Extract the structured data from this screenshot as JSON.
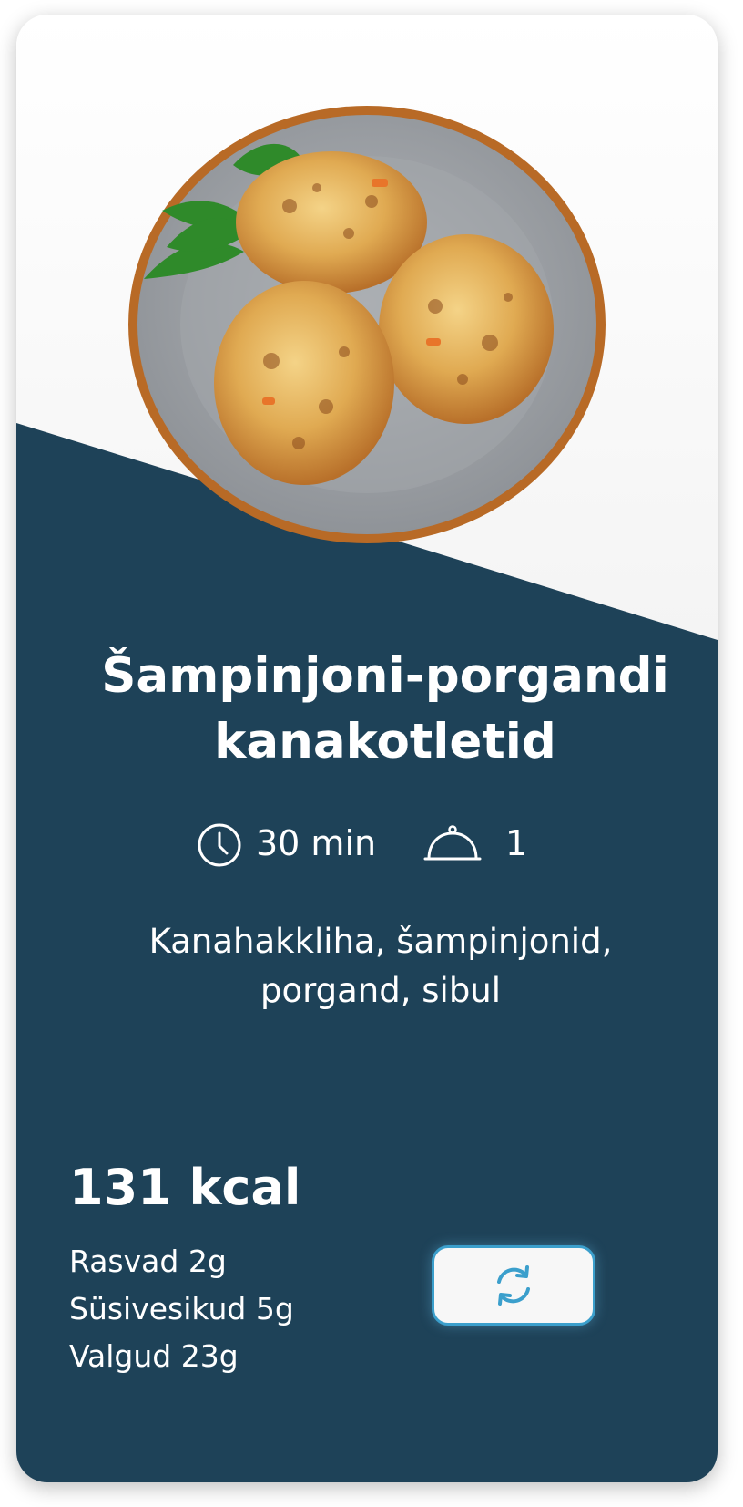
{
  "recipe": {
    "title_line1": "Šampinjoni-porgandi",
    "title_line2": "kanakotletid",
    "time": "30 min",
    "servings": "1",
    "ingredients_line1": "Kanahakkliha, šampinjonid,",
    "ingredients_line2": "porgand, sibul",
    "calories": "131 kcal",
    "nutrients": [
      {
        "label": "Rasvad",
        "value": "2g"
      },
      {
        "label": "Süsivesikud",
        "value": "5g"
      },
      {
        "label": "Valgud",
        "value": "23g"
      }
    ]
  },
  "icons": {
    "time": "clock-icon",
    "servings": "serving-cloche-icon",
    "swap": "refresh-icon"
  },
  "colors": {
    "panel": "#1e4258",
    "accent": "#3b9fcc",
    "text": "#ffffff"
  }
}
